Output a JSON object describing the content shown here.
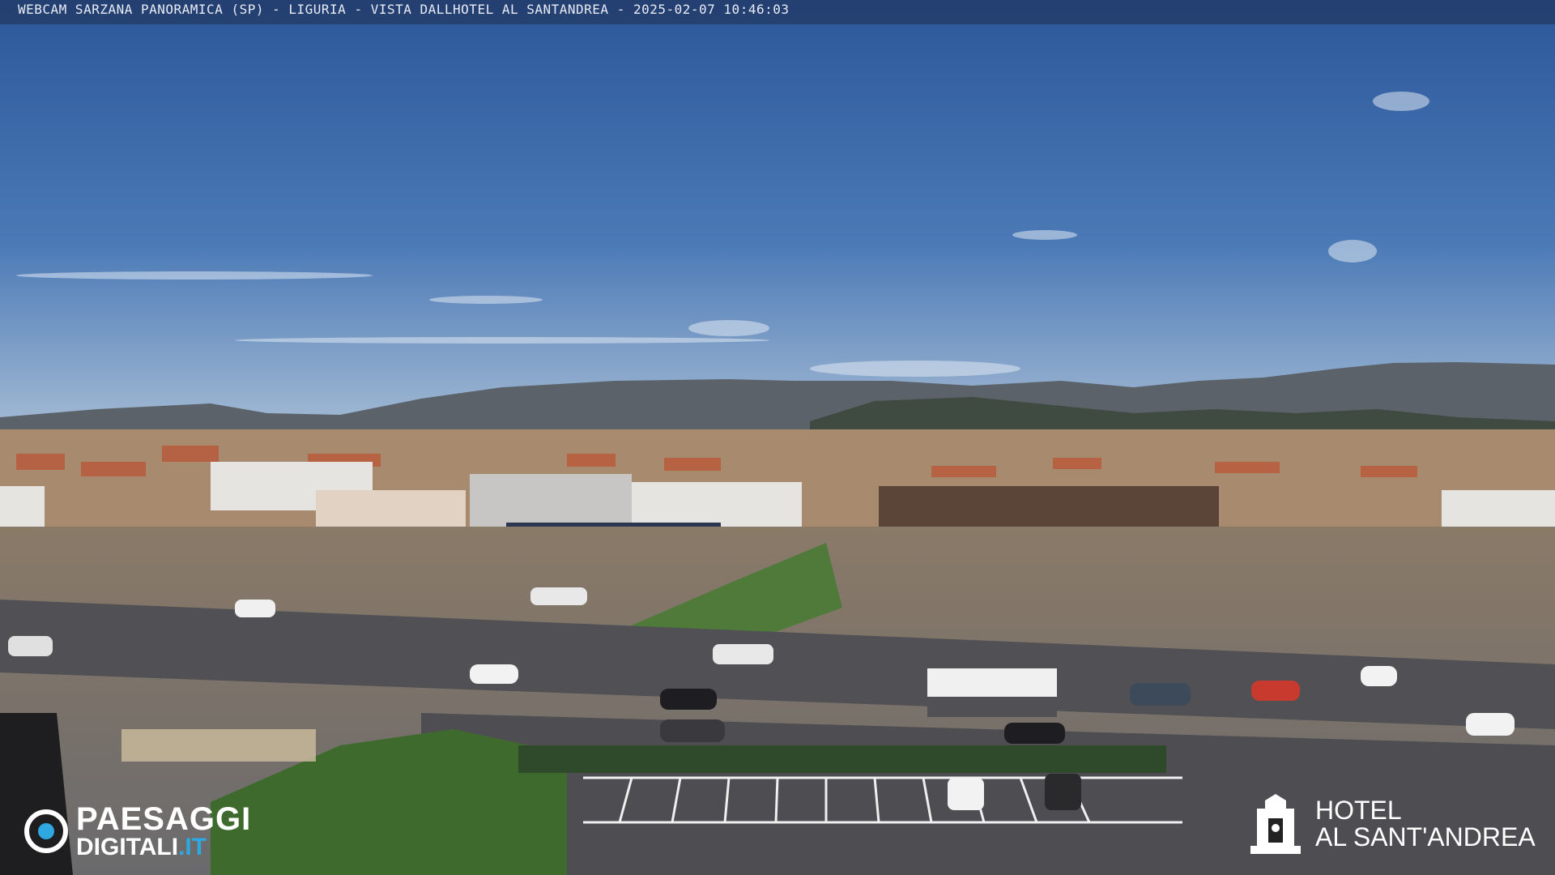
{
  "overlay": {
    "caption": "WEBCAM SARZANA PANORAMICA (SP) - LIGURIA - VISTA DALLHOTEL AL SANTANDREA - 2025-02-07  10:46:03"
  },
  "watermark_left": {
    "line1": "PAESAGGI",
    "line2_main": "DIGITALI",
    "line2_accent": ".IT",
    "accent_color": "#2fa7e0"
  },
  "watermark_right": {
    "line1": "HOTEL",
    "line2": "AL SANT'ANDREA",
    "icon": "hotel-emblem-icon"
  },
  "colors": {
    "sky_top": "#2f5c9c",
    "sky_horizon": "#a9bfd6",
    "mountains": "#4a4f52",
    "road": "#5a5a5e"
  }
}
